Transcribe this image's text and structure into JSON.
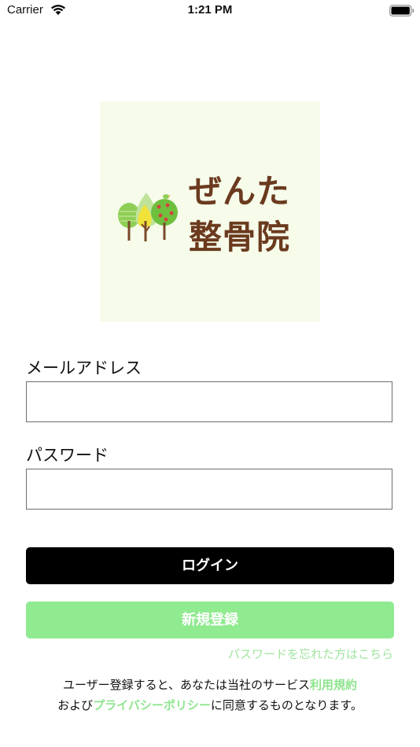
{
  "status_bar": {
    "carrier": "Carrier",
    "time": "1:21 PM"
  },
  "logo": {
    "line1": "ぜんた",
    "line2": "整骨院",
    "colors": {
      "background": "#f6fbea",
      "text": "#6b3a1e"
    }
  },
  "form": {
    "email": {
      "label": "メールアドレス",
      "value": "",
      "placeholder": ""
    },
    "password": {
      "label": "パスワード",
      "value": "",
      "placeholder": ""
    }
  },
  "buttons": {
    "login": "ログイン",
    "register": "新規登録"
  },
  "forgot_password": "パスワードを忘れた方はこちら",
  "terms": {
    "prefix": "ユーザー登録すると、あなたは当社のサービス",
    "terms_link": "利用規約",
    "middle": "および",
    "privacy_link": "プライバシーポリシー",
    "suffix": "に同意するものとなります。"
  },
  "colors": {
    "accent": "#90ea90",
    "link": "#9fe49f",
    "primary_button": "#000000"
  },
  "icons": {
    "wifi": "wifi-icon",
    "battery": "battery-icon",
    "trees": "trees-icon"
  }
}
